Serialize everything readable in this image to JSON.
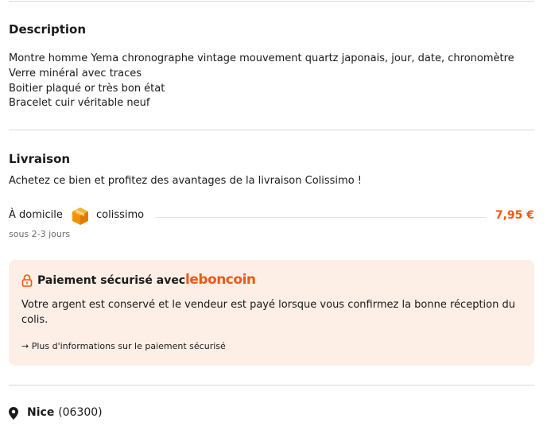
{
  "description": {
    "title": "Description",
    "lines": [
      "Montre homme Yema chronographe vintage mouvement quartz japonais, jour, date, chronomètre",
      "Verre minéral avec traces",
      "Boitier plaqué or très bon état",
      "Bracelet cuir véritable neuf"
    ]
  },
  "livraison": {
    "title": "Livraison",
    "intro": "Achetez ce bien et profitez des avantages de la livraison Colissimo !",
    "option": {
      "label": "À domicile",
      "icon": "colissimo-box-icon",
      "carrier": "colissimo",
      "price": "7,95 €",
      "delay": "sous 2-3 jours"
    }
  },
  "paiement": {
    "icon": "lock-icon",
    "title": "Paiement sécurisé avec",
    "brand": "leboncoin",
    "text": "Votre argent est conservé et le vendeur est payé lorsque vous confirmez la bonne réception du colis.",
    "link": "→ Plus d'informations sur le paiement sécurisé"
  },
  "location": {
    "icon": "map-pin-icon",
    "city": "Nice",
    "zip": "(06300)"
  },
  "colors": {
    "accent": "#ec5a13",
    "box_bg": "#fdeee6",
    "divider": "#d9d9d9"
  }
}
